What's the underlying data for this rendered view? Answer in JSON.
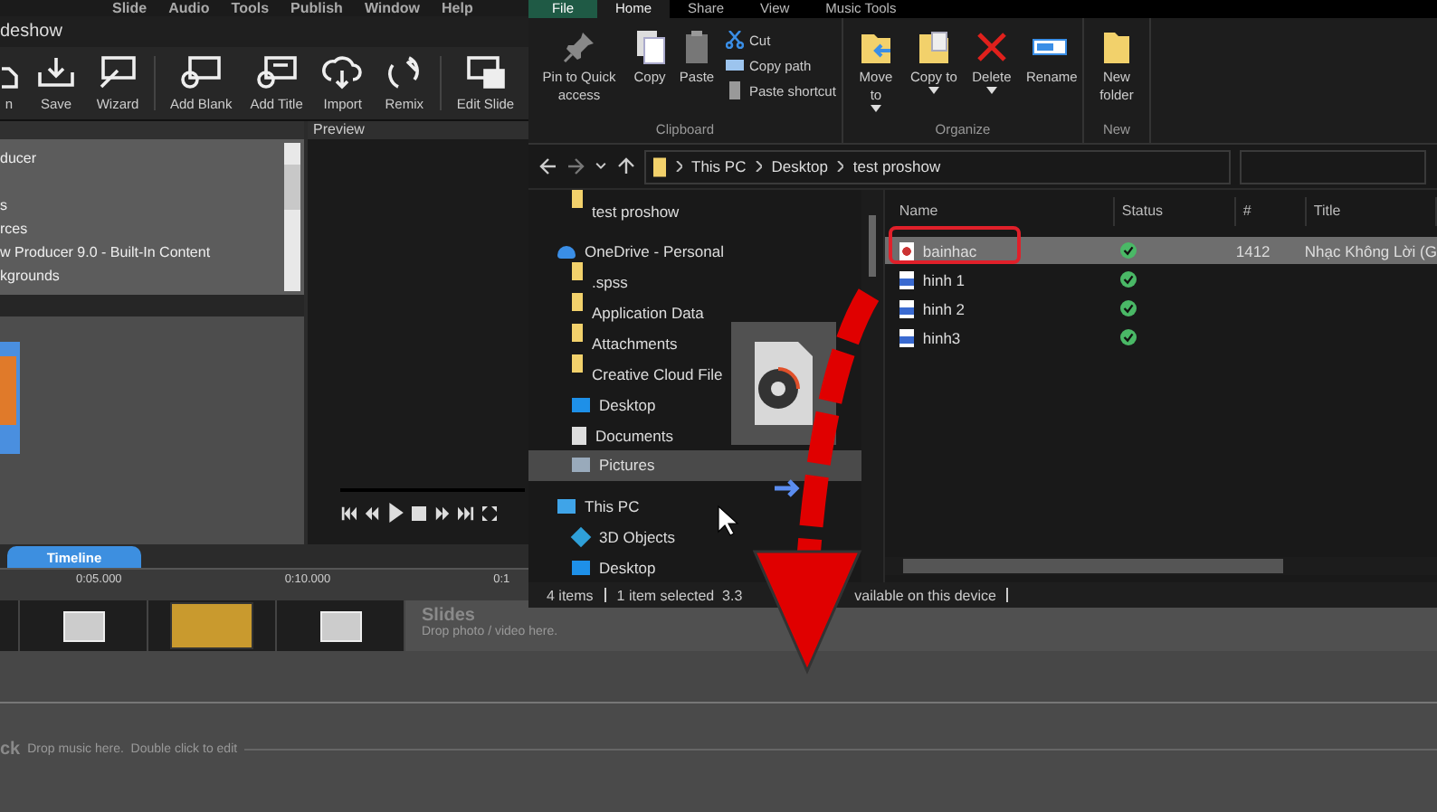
{
  "app": {
    "menu": [
      "Slide",
      "Audio",
      "Tools",
      "Publish",
      "Window",
      "Help"
    ],
    "title": "deshow",
    "toolbar": [
      "n",
      "Save",
      "Wizard",
      "Add Blank",
      "Add Title",
      "Import",
      "Remix",
      "Edit Slide"
    ],
    "folders": [
      "ducer",
      "s",
      "rces",
      "w Producer 9.0 - Built-In Content",
      "kgrounds"
    ],
    "preview_title": "Preview"
  },
  "timeline": {
    "tab": "Timeline",
    "ruler": [
      "0:05.000",
      "0:10.000",
      "0:1"
    ],
    "slides": [
      {
        "kind": "title"
      },
      {
        "kind": "photo"
      },
      {
        "kind": "title"
      }
    ],
    "slides_label": "Slides",
    "slides_hint": "Drop photo / video here.",
    "sound_label": "ck",
    "sound_hint": "Drop music here.  Double click to edit"
  },
  "explorer": {
    "file_tab": "File",
    "tabs": [
      {
        "label": "Home",
        "selected": true
      },
      {
        "label": "Share",
        "selected": false
      },
      {
        "label": "View",
        "selected": false
      },
      {
        "label": "Music Tools",
        "selected": false
      }
    ],
    "groups": [
      {
        "label": "Clipboard",
        "large": [
          {
            "label": "Pin to Quick access",
            "caret": false
          },
          {
            "label": "Copy",
            "caret": false
          },
          {
            "label": "Paste",
            "caret": false
          }
        ],
        "small": [
          "Cut",
          "Copy path",
          "Paste shortcut"
        ]
      },
      {
        "label": "Organize",
        "large": [
          {
            "label": "Move to",
            "caret": true
          },
          {
            "label": "Copy to",
            "caret": true
          },
          {
            "label": "Delete",
            "caret": true
          },
          {
            "label": "Rename",
            "caret": false
          }
        ]
      },
      {
        "label": "New",
        "large": [
          {
            "label": "New folder",
            "caret": false
          }
        ]
      }
    ],
    "crumbs": [
      "This PC",
      "Desktop",
      "test proshow"
    ],
    "pinned": [
      {
        "label": "test proshow",
        "kind": "folder",
        "selected": false
      }
    ],
    "tree": [
      {
        "label": "OneDrive - Personal",
        "kind": "cloud",
        "selected": false,
        "children": [
          {
            "label": ".spss",
            "kind": "folder",
            "selected": false
          },
          {
            "label": "Application Data",
            "kind": "folder",
            "selected": false
          },
          {
            "label": "Attachments",
            "kind": "folder",
            "selected": false
          },
          {
            "label": "Creative Cloud File",
            "kind": "folder",
            "selected": false
          },
          {
            "label": "Desktop",
            "kind": "desktop",
            "selected": false
          },
          {
            "label": "Documents",
            "kind": "documents",
            "selected": false
          },
          {
            "label": "Pictures",
            "kind": "pictures",
            "selected": true
          }
        ]
      },
      {
        "label": "This PC",
        "kind": "pc",
        "selected": false,
        "children": [
          {
            "label": "3D Objects",
            "kind": "cube",
            "selected": false
          },
          {
            "label": "Desktop",
            "kind": "desktop",
            "selected": false
          }
        ]
      }
    ],
    "columns": [
      "Name",
      "Status",
      "#",
      "Title"
    ],
    "files": [
      {
        "name": "bainhac",
        "kind": "audio",
        "synced": true,
        "number": "1412",
        "title": "Nhạc Không Lời (G",
        "selected": true,
        "circled": true
      },
      {
        "name": "hinh 1",
        "kind": "image",
        "synced": true,
        "selected": false,
        "circled": false
      },
      {
        "name": "hinh 2",
        "kind": "image",
        "synced": true,
        "selected": false,
        "circled": false
      },
      {
        "name": "hinh3",
        "kind": "image",
        "synced": true,
        "selected": false,
        "circled": false
      }
    ],
    "status": {
      "count": "4 items",
      "selection": "1 item selected  3.3",
      "availability": "vailable on this device"
    }
  }
}
